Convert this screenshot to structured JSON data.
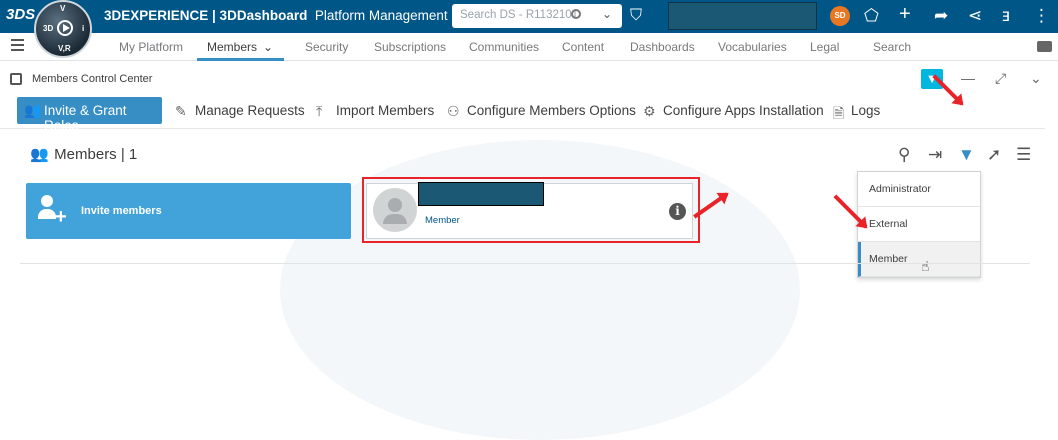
{
  "topbar": {
    "brand_logo": "3DS",
    "compass": {
      "top": "V",
      "left": "3D",
      "right": "i",
      "bottom": "V,R"
    },
    "app_title_bold": "3DEXPERIENCE | 3DDashboard",
    "app_title_rest": "Platform Management",
    "search_placeholder": "Search DS - R1132101",
    "avatar_initials": "SD",
    "icons": [
      "tag-icon",
      "share-icon",
      "plus-icon",
      "forward-icon",
      "network-icon",
      "apps-icon"
    ]
  },
  "nav": {
    "items": [
      {
        "label": "My Platform",
        "active": false
      },
      {
        "label": "Members",
        "active": true
      },
      {
        "label": "Security",
        "active": false
      },
      {
        "label": "Subscriptions",
        "active": false
      },
      {
        "label": "Communities",
        "active": false
      },
      {
        "label": "Content",
        "active": false
      },
      {
        "label": "Dashboards",
        "active": false
      },
      {
        "label": "Vocabularies",
        "active": false
      },
      {
        "label": "Legal",
        "active": false
      },
      {
        "label": "Search",
        "active": false
      }
    ]
  },
  "widget": {
    "title": "Members Control Center"
  },
  "toolbar": {
    "invite_grant": "Invite & Grant Roles",
    "manage_requests": "Manage Requests",
    "import_members": "Import Members",
    "configure_members": "Configure Members Options",
    "configure_apps": "Configure Apps Installation",
    "logs": "Logs"
  },
  "members": {
    "header": "Members | 1",
    "invite_label": "Invite members",
    "card": {
      "role": "Member",
      "info": "i"
    }
  },
  "filter_dropdown": {
    "options": [
      "Administrator",
      "External",
      "Member"
    ],
    "selected": "Member"
  },
  "colors": {
    "topbar": "#005686",
    "accent": "#368ec4",
    "invite_card": "#42a2da",
    "filter": "#00b8de",
    "annotation": "#e8232a"
  }
}
